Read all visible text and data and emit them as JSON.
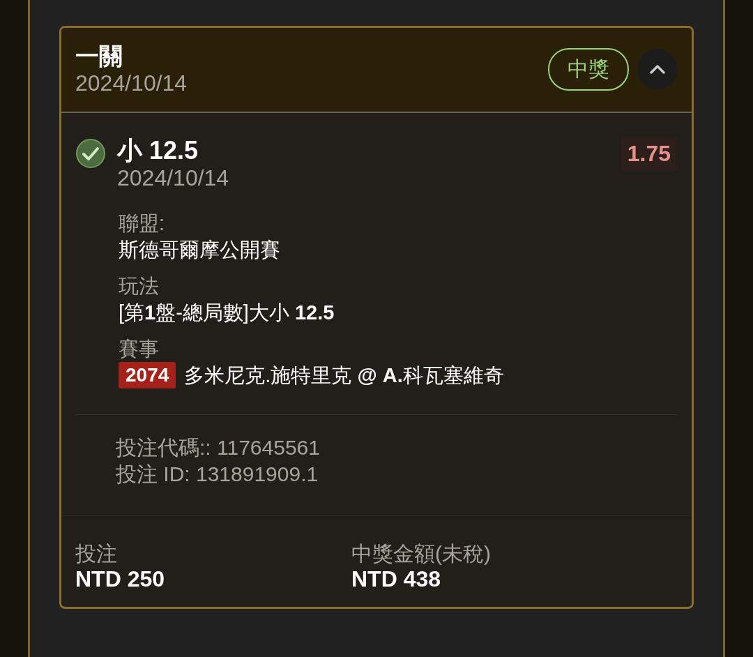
{
  "bet": {
    "title": "一關",
    "date": "2024/10/14",
    "status": {
      "label": "中獎",
      "kind": "won"
    },
    "expanded": true
  },
  "selection": {
    "won": true,
    "title": "小 12.5",
    "date": "2024/10/14",
    "odds": "1.75"
  },
  "details": [
    {
      "label": "聯盟:",
      "value": "斯德哥爾摩公開賽"
    },
    {
      "label": "玩法",
      "value": "[第**1**盤-總局數]大小 **12.5**"
    }
  ],
  "event": {
    "label": "賽事",
    "code": "2074",
    "matchup": "多米尼克.施特里克 **@ A.**科瓦塞維奇"
  },
  "references": [
    "投注代碼:: 117645561",
    "投注 ID: 131891909.1"
  ],
  "totals": [
    {
      "label": "投注",
      "value": "NTD 250"
    },
    {
      "label": "中獎金額(未稅)",
      "value": "NTD 438"
    }
  ]
}
